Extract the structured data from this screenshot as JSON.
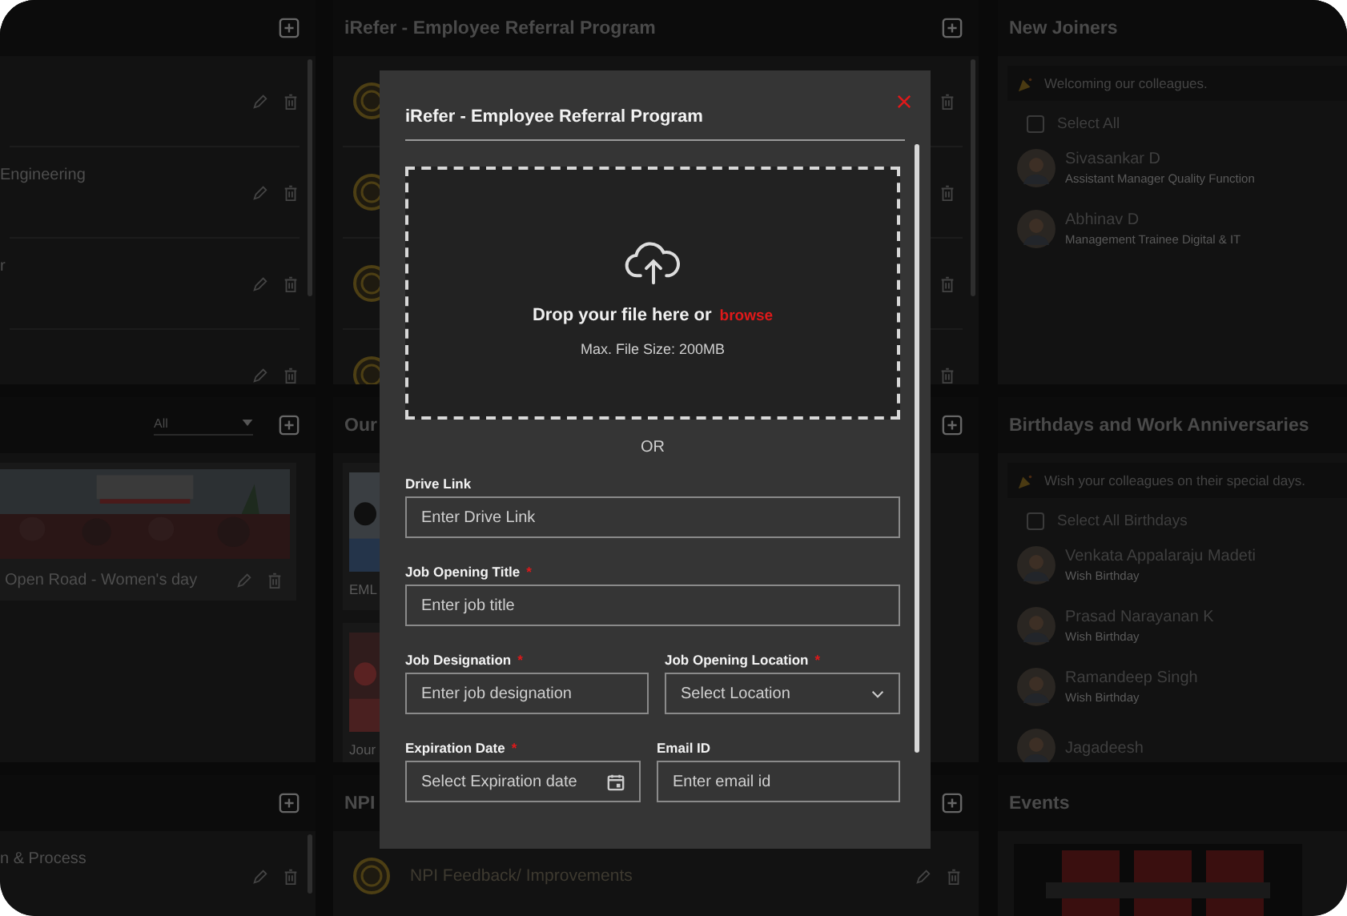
{
  "left_column": {
    "top_panel": {
      "rows": [
        {},
        {
          "title": "Engineering"
        },
        {
          "title": "r"
        },
        {}
      ]
    },
    "gallery_panel": {
      "filter": "All",
      "cards": [
        {
          "caption": "Open Road - Women's day"
        }
      ]
    },
    "bottom_panel": {
      "rows": [
        {
          "title": "n & Process"
        }
      ]
    }
  },
  "middle_column": {
    "referral_panel": {
      "title": "iRefer - Employee Referral Program",
      "rows": [
        {},
        {},
        {},
        {}
      ]
    },
    "stories_panel": {
      "title": "Our",
      "cards": [
        {
          "caption": "EML"
        },
        {
          "caption": "Jour"
        }
      ]
    },
    "npi_panel": {
      "title": "NPI",
      "rows": [
        {
          "title": "NPI Feedback/ Improvements"
        }
      ]
    }
  },
  "right_column": {
    "new_joiners": {
      "title": "New Joiners",
      "banner": "Welcoming our colleagues.",
      "select_all": {
        "label": "Select All",
        "checked": false
      },
      "people": [
        {
          "name": "Sivasankar D",
          "subtitle": "Assistant Manager Quality Function"
        },
        {
          "name": "Abhinav D",
          "subtitle": "Management Trainee Digital & IT"
        }
      ]
    },
    "birthdays": {
      "title": "Birthdays and Work Anniversaries",
      "banner": "Wish your colleagues on their special days.",
      "select_all": {
        "label": "Select All Birthdays",
        "checked": false
      },
      "people": [
        {
          "name": "Venkata Appalaraju Madeti",
          "subtitle": "Wish Birthday"
        },
        {
          "name": "Prasad Narayanan K",
          "subtitle": "Wish Birthday"
        },
        {
          "name": "Ramandeep Singh",
          "subtitle": "Wish Birthday"
        },
        {
          "name": "Jagadeesh"
        }
      ]
    },
    "events": {
      "title": "Events"
    }
  },
  "modal": {
    "title": "iRefer - Employee Referral Program",
    "upload": {
      "prompt": "Drop your file here or",
      "link": "browse",
      "note": "Max. File Size: 200MB"
    },
    "separator": "OR",
    "field_rows": [
      [
        {
          "kind": "text",
          "label": "Drive Link",
          "placeholder": "Enter Drive Link"
        }
      ],
      [
        {
          "kind": "text",
          "label": "Job Opening Title",
          "required_mark": "*",
          "placeholder": "Enter job title"
        }
      ],
      [
        {
          "kind": "text",
          "label": "Job Designation",
          "required_mark": "*",
          "placeholder": "Enter job designation"
        },
        {
          "kind": "select",
          "label": "Job Opening Location",
          "required_mark": "*",
          "placeholder": "Select Location"
        }
      ],
      [
        {
          "kind": "date",
          "label": "Expiration Date",
          "required_mark": "*",
          "placeholder": "Select Expiration date"
        },
        {
          "kind": "text",
          "label": "Email ID",
          "placeholder": "Enter email id"
        }
      ]
    ]
  }
}
